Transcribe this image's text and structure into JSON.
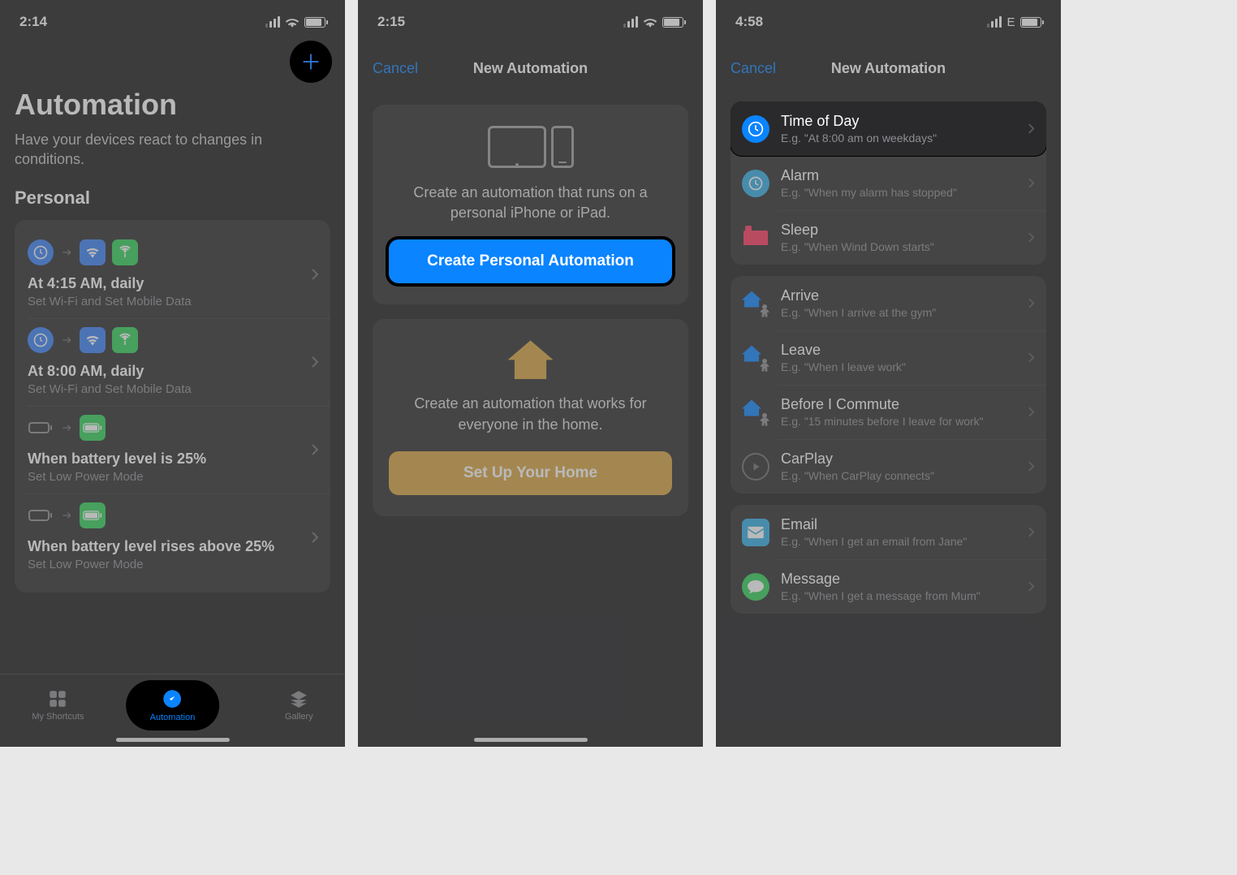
{
  "screen1": {
    "time": "2:14",
    "title": "Automation",
    "subtitle": "Have your devices react to changes in conditions.",
    "section": "Personal",
    "items": [
      {
        "title": "At 4:15 AM, daily",
        "sub": "Set Wi-Fi and Set Mobile Data",
        "icons": [
          "clock",
          "wifi",
          "cell"
        ]
      },
      {
        "title": "At 8:00 AM, daily",
        "sub": "Set Wi-Fi and Set Mobile Data",
        "icons": [
          "clock",
          "wifi",
          "cell"
        ]
      },
      {
        "title": "When battery level is 25%",
        "sub": "Set Low Power Mode",
        "icons": [
          "battery-empty",
          "battery-low"
        ]
      },
      {
        "title": "When battery level rises above 25%",
        "sub": "Set Low Power Mode",
        "icons": [
          "battery-empty",
          "battery-low"
        ]
      }
    ],
    "tabs": {
      "shortcuts": "My Shortcuts",
      "automation": "Automation",
      "gallery": "Gallery"
    }
  },
  "screen2": {
    "time": "2:15",
    "cancel": "Cancel",
    "title": "New Automation",
    "personal_desc": "Create an automation that runs on a personal iPhone or iPad.",
    "personal_btn": "Create Personal Automation",
    "home_desc": "Create an automation that works for everyone in the home.",
    "home_btn": "Set Up Your Home"
  },
  "screen3": {
    "time": "4:58",
    "net": "E",
    "cancel": "Cancel",
    "title": "New Automation",
    "groups": [
      [
        {
          "title": "Time of Day",
          "sub": "E.g. \"At 8:00 am on weekdays\"",
          "icon": "clock",
          "color": "blue",
          "highlighted": true
        },
        {
          "title": "Alarm",
          "sub": "E.g. \"When my alarm has stopped\"",
          "icon": "clock",
          "color": "teal"
        },
        {
          "title": "Sleep",
          "sub": "E.g. \"When Wind Down starts\"",
          "icon": "bed",
          "color": "pink"
        }
      ],
      [
        {
          "title": "Arrive",
          "sub": "E.g. \"When I arrive at the gym\"",
          "icon": "house-person",
          "color": "blue"
        },
        {
          "title": "Leave",
          "sub": "E.g. \"When I leave work\"",
          "icon": "house-person",
          "color": "blue"
        },
        {
          "title": "Before I Commute",
          "sub": "E.g. \"15 minutes before I leave for work\"",
          "icon": "house-person",
          "color": "blue"
        },
        {
          "title": "CarPlay",
          "sub": "E.g. \"When CarPlay connects\"",
          "icon": "carplay",
          "color": "outline"
        }
      ],
      [
        {
          "title": "Email",
          "sub": "E.g. \"When I get an email from Jane\"",
          "icon": "mail",
          "color": "teal"
        },
        {
          "title": "Message",
          "sub": "E.g. \"When I get a message from Mum\"",
          "icon": "message",
          "color": "green"
        }
      ]
    ]
  }
}
